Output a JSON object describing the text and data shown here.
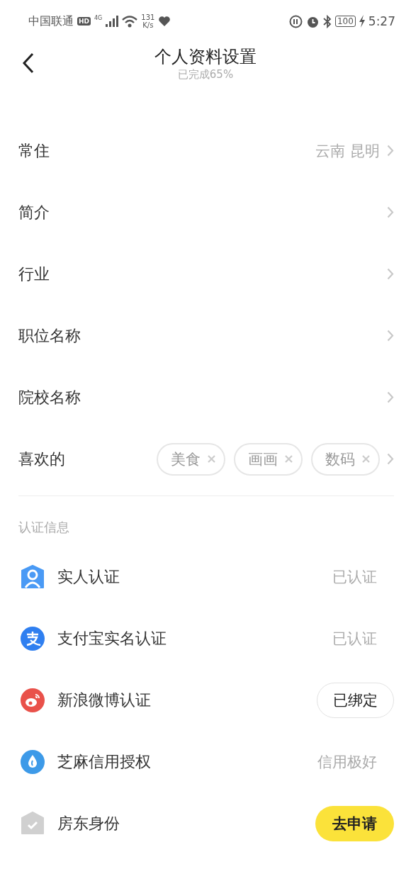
{
  "status_bar": {
    "carrier": "中国联通",
    "hd_badge": "HD",
    "network": "4G",
    "speed": "131",
    "speed_unit": "K/s",
    "battery": "100",
    "time": "5:27"
  },
  "header": {
    "title": "个人资料设置",
    "subtitle": "已完成65%"
  },
  "profile_rows": [
    {
      "label": "常住",
      "value": "云南 昆明"
    },
    {
      "label": "简介"
    },
    {
      "label": "行业"
    },
    {
      "label": "职位名称"
    },
    {
      "label": "院校名称"
    },
    {
      "label": "喜欢的",
      "tags": [
        "美食",
        "画画",
        "数码"
      ]
    }
  ],
  "verification": {
    "title": "认证信息",
    "items": [
      {
        "label": "实人认证",
        "kind": "text",
        "status": "已认证"
      },
      {
        "label": "支付宝实名认证",
        "kind": "text",
        "status": "已认证"
      },
      {
        "label": "新浪微博认证",
        "kind": "outline-button",
        "status": "已绑定"
      },
      {
        "label": "芝麻信用授权",
        "kind": "text",
        "status": "信用极好"
      },
      {
        "label": "房东身份",
        "kind": "primary-button",
        "status": "去申请"
      }
    ]
  }
}
